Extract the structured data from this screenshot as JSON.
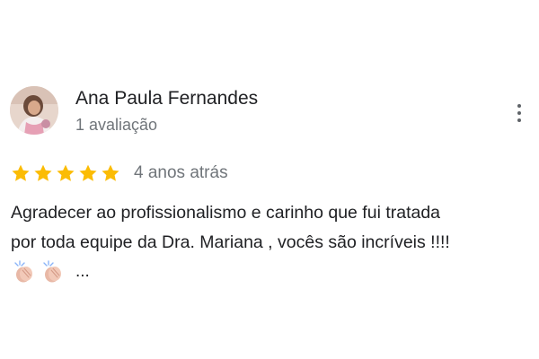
{
  "review": {
    "reviewer_name": "Ana Paula Fernandes",
    "review_count": "1 avaliação",
    "rating": 5,
    "rating_max": 5,
    "date": "4 anos atrás",
    "text_lines": [
      "Agradecer ao profissionalismo e carinho que fui tratada",
      "por toda equipe da Dra. Mariana , vocês são incríveis !!!!"
    ],
    "more_label": "...",
    "emoji_icons": [
      "clapping-hands-icon",
      "clapping-hands-icon"
    ],
    "menu_icon": "more-vert-icon"
  },
  "colors": {
    "star": "#FBBC04",
    "name": "#202124",
    "secondary": "#70757A",
    "menu": "#5F6368"
  }
}
